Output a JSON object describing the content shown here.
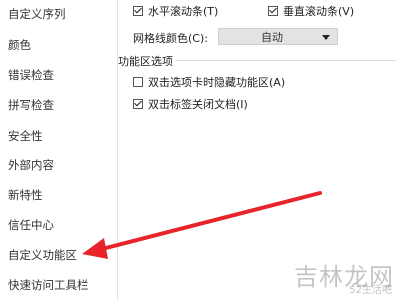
{
  "sidebar": {
    "items": [
      {
        "label": "自定义序列"
      },
      {
        "label": "颜色"
      },
      {
        "label": "错误检查"
      },
      {
        "label": "拼写检查"
      },
      {
        "label": "安全性"
      },
      {
        "label": "外部内容"
      },
      {
        "label": "新特性"
      },
      {
        "label": "信任中心"
      },
      {
        "label": "自定义功能区"
      },
      {
        "label": "快速访问工具栏"
      }
    ]
  },
  "view_options": {
    "horizontal_scrollbar": {
      "label": "水平滚动条(T)",
      "checked": true
    },
    "vertical_scrollbar": {
      "label": "垂直滚动条(V)",
      "checked": true
    },
    "gridline_color": {
      "label": "网格线颜色(C):",
      "value": "自动"
    }
  },
  "ribbon_options": {
    "title": "功能区选项",
    "double_click_hide": {
      "label": "双击选项卡时隐藏功能区(A)",
      "checked": false
    },
    "double_click_close": {
      "label": "双击标签关闭文档(I)",
      "checked": true
    }
  },
  "watermark": {
    "main": "吉林龙网",
    "sub": "52生活吧"
  },
  "colors": {
    "arrow": "#e8232a"
  }
}
